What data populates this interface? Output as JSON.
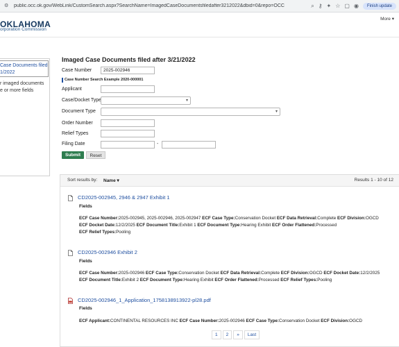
{
  "browser": {
    "url": "public.occ.ok.gov/WebLink/CustomSearch.aspx?SearchName=ImagedCaseDocumentsfiledafter3212022&dbid=0&repo=OCC",
    "finish_update_label": "Finish update"
  },
  "header": {
    "logo_main": "OKLAHOMA",
    "logo_sub": "orporation Commission",
    "more_label": "More ▾"
  },
  "sidebar": {
    "link_line1": "Case Documents filed",
    "link_line2": "1/2022",
    "desc_line1": "r imaged documents",
    "desc_line2": "e or more fields"
  },
  "form": {
    "title": "Imaged Case Documents filed after 3/21/2022",
    "case_number_label": "Case Number",
    "case_number_value": "2025-002946",
    "example_note": "Case Number Search Example 2020-000001",
    "applicant_label": "Applicant",
    "case_docket_type_label": "Case/Docket Type",
    "document_type_label": "Document Type",
    "order_number_label": "Order Number",
    "relief_types_label": "Relief Types",
    "filing_date_label": "Filing Date",
    "date_separator": "-",
    "submit_label": "Submit",
    "reset_label": "Reset"
  },
  "results": {
    "sort_label": "Sort results by:",
    "sort_value": "Name ▾",
    "count_text": "Results  1 - 10 of 12",
    "fields_label": "Fields",
    "items": [
      {
        "title": "CD2025-002945, 2946 & 2947 Exhibit 1",
        "icon": "document-icon",
        "lines": [
          [
            {
              "k": "ECF Case Number:",
              "v": "2025-002945, 2025-002946, 2025-002947 "
            },
            {
              "k": "ECF Case Type:",
              "v": "Conservation Docket "
            },
            {
              "k": "ECF Data Retrieval:",
              "v": "Complete "
            },
            {
              "k": "ECF Division:",
              "v": "OGCD"
            }
          ],
          [
            {
              "k": "ECF Docket Date:",
              "v": "12/2/2025 "
            },
            {
              "k": "ECF Document Title:",
              "v": "Exhibit 1 "
            },
            {
              "k": "ECF Document Type:",
              "v": "Hearing Exhibit "
            },
            {
              "k": "ECF Order Flattened:",
              "v": "Processed"
            }
          ],
          [
            {
              "k": "ECF Relief Types:",
              "v": "Pooling"
            }
          ]
        ]
      },
      {
        "title": "CD2025-002946 Exhibit 2",
        "icon": "document-icon",
        "lines": [
          [
            {
              "k": "ECF Case Number:",
              "v": "2025-002946 "
            },
            {
              "k": "ECF Case Type:",
              "v": "Conservation Docket "
            },
            {
              "k": "ECF Data Retrieval:",
              "v": "Complete "
            },
            {
              "k": "ECF Division:",
              "v": "OGCD "
            },
            {
              "k": "ECF Docket Date:",
              "v": "12/2/2025"
            }
          ],
          [
            {
              "k": "ECF Document Title:",
              "v": "Exhibit 2 "
            },
            {
              "k": "ECF Document Type:",
              "v": "Hearing Exhibit "
            },
            {
              "k": "ECF Order Flattened:",
              "v": "Processed "
            },
            {
              "k": "ECF Relief Types:",
              "v": "Pooling"
            }
          ]
        ]
      },
      {
        "title": "CD2025-002946_1_Application_1758138913922-pl28.pdf",
        "icon": "pdf-icon",
        "lines": [
          [
            {
              "k": "ECF Applicant:",
              "v": "CONTINENTAL RESOURCES INC "
            },
            {
              "k": "ECF Case Number:",
              "v": "2025-002946 "
            },
            {
              "k": "ECF Case Type:",
              "v": "Conservation Docket "
            },
            {
              "k": "ECF Division:",
              "v": "OGCD"
            }
          ]
        ]
      }
    ],
    "pagination": [
      "1",
      "2",
      "»",
      "Last"
    ]
  }
}
